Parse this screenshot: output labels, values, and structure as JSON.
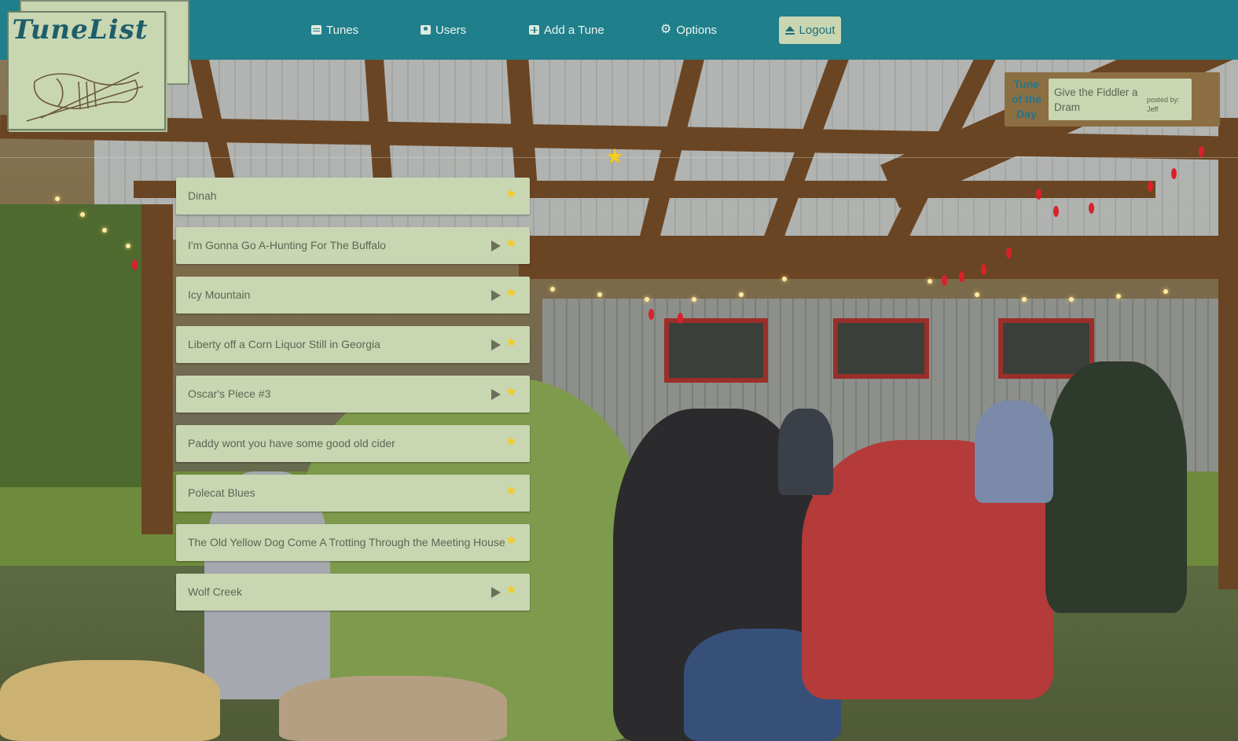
{
  "app": {
    "logo_text": "TuneList"
  },
  "nav": {
    "items": [
      {
        "label": "Tunes",
        "icon": "list-icon"
      },
      {
        "label": "Users",
        "icon": "user-icon"
      },
      {
        "label": "Add a Tune",
        "icon": "plus-square-icon"
      },
      {
        "label": "Options",
        "icon": "gears-icon"
      }
    ],
    "logout_label": "Logout",
    "logout_icon": "eject-icon"
  },
  "tune_of_the_day": {
    "label": "Tune of the Day",
    "title": "Give the Fiddler a Dram",
    "posted_by": "posted by: Jeff"
  },
  "tunes": [
    {
      "name": "Dinah",
      "has_audio": false,
      "starred": true
    },
    {
      "name": "I'm Gonna Go A-Hunting For The Buffalo",
      "has_audio": true,
      "starred": true
    },
    {
      "name": "Icy Mountain",
      "has_audio": true,
      "starred": true
    },
    {
      "name": "Liberty off a Corn Liquor Still in Georgia",
      "has_audio": true,
      "starred": true
    },
    {
      "name": "Oscar's Piece #3",
      "has_audio": true,
      "starred": true
    },
    {
      "name": "Paddy wont you have some good old cider",
      "has_audio": false,
      "starred": true
    },
    {
      "name": "Polecat Blues",
      "has_audio": false,
      "starred": true
    },
    {
      "name": "The Old Yellow Dog Come A Trotting Through the Meeting House",
      "has_audio": false,
      "starred": true
    },
    {
      "name": "Wolf Creek",
      "has_audio": true,
      "starred": true
    }
  ],
  "colors": {
    "header": "#1f7f8b",
    "card": "#c9d6b2",
    "star": "#f3cc24",
    "tune_of_day_panel": "#8b6f43"
  }
}
